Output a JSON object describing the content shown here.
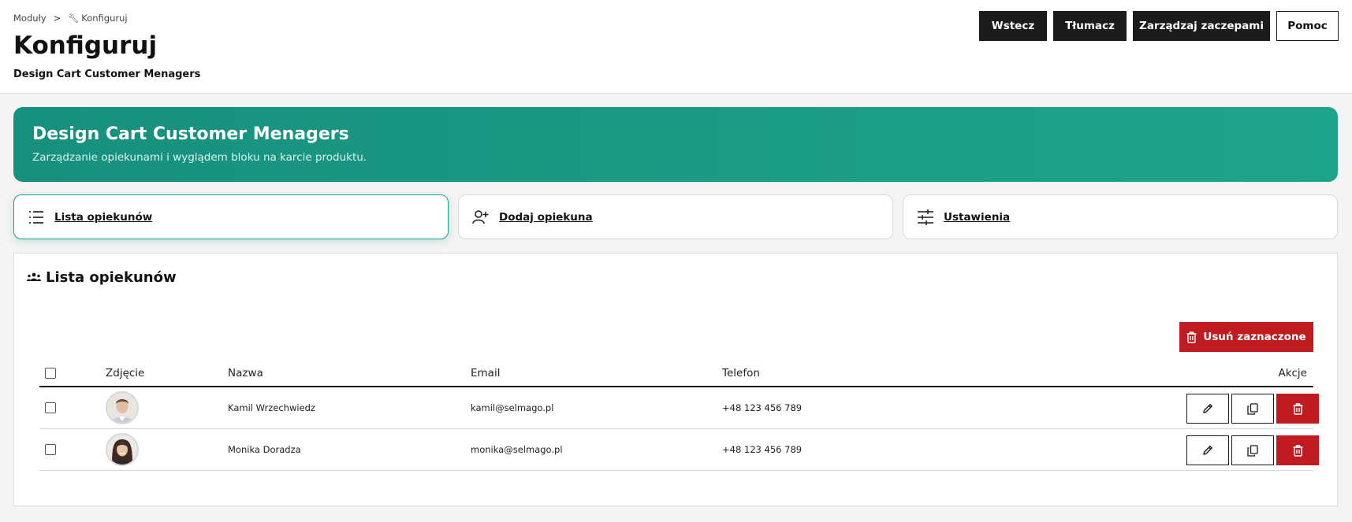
{
  "breadcrumb": {
    "parent": "Moduły",
    "separator": ">",
    "current": "Konfiguruj"
  },
  "header": {
    "title": "Konfiguruj",
    "subtitle": "Design Cart Customer Menagers",
    "buttons": {
      "back": "Wstecz",
      "translate": "Tłumacz",
      "hooks": "Zarządzaj zaczepami",
      "help": "Pomoc"
    }
  },
  "hero": {
    "title": "Design Cart Customer Menagers",
    "description": "Zarządzanie opiekunami i wyglądem bloku na karcie produktu."
  },
  "tabs": [
    {
      "label": "Lista opiekunów",
      "icon": "list-icon",
      "active": true
    },
    {
      "label": "Dodaj opiekuna",
      "icon": "user-plus-icon",
      "active": false
    },
    {
      "label": "Ustawienia",
      "icon": "sliders-icon",
      "active": false
    }
  ],
  "panel": {
    "title": "Lista opiekunów",
    "delete_selected": "Usuń zaznaczone",
    "columns": {
      "photo": "Zdjęcie",
      "name": "Nazwa",
      "email": "Email",
      "phone": "Telefon",
      "actions": "Akcje"
    },
    "rows": [
      {
        "name": "Kamil Wrzechwiedz",
        "email": "kamil@selmago.pl",
        "phone": "+48 123 456 789"
      },
      {
        "name": "Monika Doradza",
        "email": "monika@selmago.pl",
        "phone": "+48 123 456 789"
      }
    ]
  },
  "colors": {
    "accent": "#1aa089",
    "danger": "#c11b22",
    "dark": "#1b1b1b"
  }
}
